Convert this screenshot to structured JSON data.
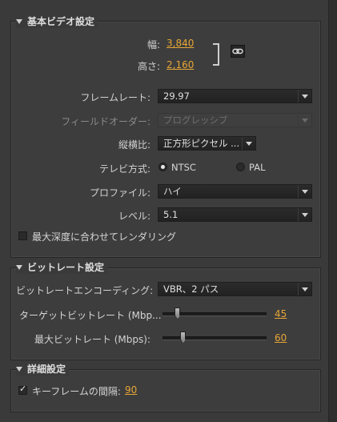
{
  "basic": {
    "title": "基本ビデオ設定",
    "width_label": "幅:",
    "width_value": "3,840",
    "height_label": "高さ:",
    "height_value": "2,160",
    "framerate_label": "フレームレート:",
    "framerate_value": "29.97",
    "field_label": "フィールドオーダー:",
    "field_value": "プログレッシブ",
    "aspect_label": "縦横比:",
    "aspect_value": "正方形ピクセル ...",
    "tv_label": "テレビ方式:",
    "tv_ntsc": "NTSC",
    "tv_pal": "PAL",
    "profile_label": "プロファイル:",
    "profile_value": "ハイ",
    "level_label": "レベル:",
    "level_value": "5.1",
    "maxdepth_label": "最大深度に合わせてレンダリング"
  },
  "bitrate": {
    "title": "ビットレート設定",
    "encoding_label": "ビットレートエンコーディング:",
    "encoding_value": "VBR、2 パス",
    "target_label": "ターゲットビットレート (Mbp...",
    "target_value": "45",
    "max_label": "最大ビットレート (Mbps):",
    "max_value": "60"
  },
  "advanced": {
    "title": "詳細設定",
    "keyframe_label": "キーフレームの間隔:",
    "keyframe_value": "90"
  }
}
